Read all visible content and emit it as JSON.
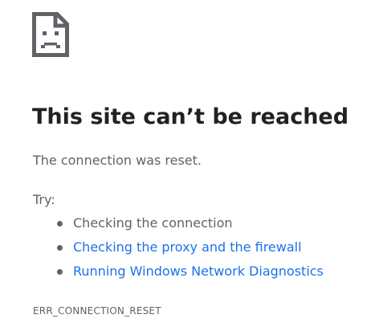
{
  "icon": "sad-document-icon",
  "title": "This site can’t be reached",
  "message": "The connection was reset.",
  "try_label": "Try:",
  "suggestions": [
    {
      "text": "Checking the connection",
      "is_link": false
    },
    {
      "text": "Checking the proxy and the firewall",
      "is_link": true
    },
    {
      "text": "Running Windows Network Diagnostics",
      "is_link": true
    }
  ],
  "error_code": "ERR_CONNECTION_RESET",
  "colors": {
    "title": "#202124",
    "text": "#5f6368",
    "link": "#1a73e8",
    "icon": "#5f6368"
  }
}
